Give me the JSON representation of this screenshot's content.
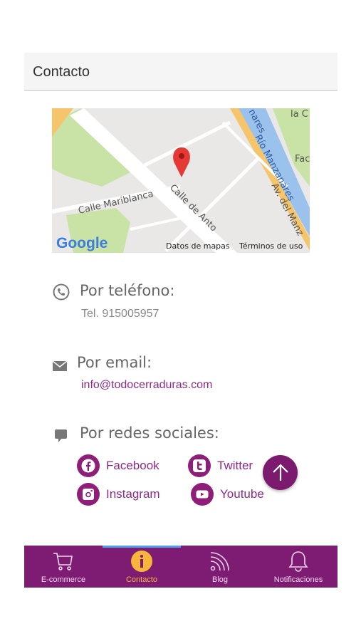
{
  "header": {
    "title": "Contacto"
  },
  "map": {
    "street_labels": [
      "Calle Mariblanca",
      "Calle de Anto",
      "Río Manzanares",
      "Av. del Manz",
      "nares",
      "la C",
      "Fac"
    ],
    "logo": "Google",
    "attribution": "Datos de mapas",
    "terms": "Términos de uso",
    "marker_color": "#e53935"
  },
  "phone": {
    "title": "Por teléfono:",
    "detail": "Tel. 915005957",
    "icon": "phone-icon"
  },
  "email": {
    "title": "Por email:",
    "detail": "info@todocerraduras.com",
    "icon": "envelope-icon"
  },
  "social": {
    "title": "Por redes sociales:",
    "icon": "chat-bubble-icon",
    "items": [
      {
        "label": "Facebook",
        "icon": "facebook-icon"
      },
      {
        "label": "Twitter",
        "icon": "twitter-icon"
      },
      {
        "label": "Instagram",
        "icon": "instagram-icon"
      },
      {
        "label": "Youtube",
        "icon": "youtube-icon"
      }
    ]
  },
  "tabs": [
    {
      "label": "E-commerce",
      "icon": "cart-icon"
    },
    {
      "label": "Contacto",
      "icon": "info-icon",
      "active": true
    },
    {
      "label": "Blog",
      "icon": "rss-icon"
    },
    {
      "label": "Notificaciones",
      "icon": "bell-icon"
    }
  ],
  "colors": {
    "brand": "#7d1c72",
    "active_tab": "#f7b53b",
    "indicator": "#4aa3e6",
    "link": "#8e2a8a"
  }
}
